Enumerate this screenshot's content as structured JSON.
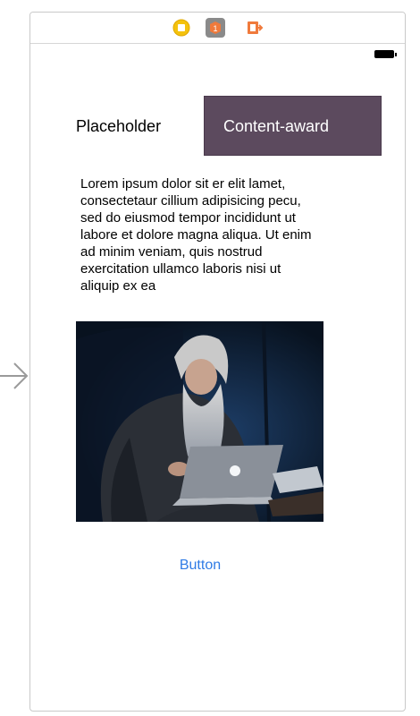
{
  "scene": {
    "dock_icons": [
      "view-controller-icon",
      "first-responder-icon",
      "exit-icon"
    ]
  },
  "header": {
    "placeholder_label": "Placeholder",
    "award_label": "Content-award",
    "award_color": "#5c4a5e"
  },
  "content": {
    "body_text": "Lorem ipsum dolor sit er elit lamet, consectetaur cillium adipisicing pecu, sed do eiusmod tempor incididunt ut labore et dolore magna aliqua. Ut enim ad minim veniam, quis nostrud exercitation ullamco laboris nisi ut aliquip ex ea",
    "image_subject": "bearded-man-with-laptop-photo"
  },
  "actions": {
    "button_label": "Button",
    "button_color": "#2f7be5"
  }
}
